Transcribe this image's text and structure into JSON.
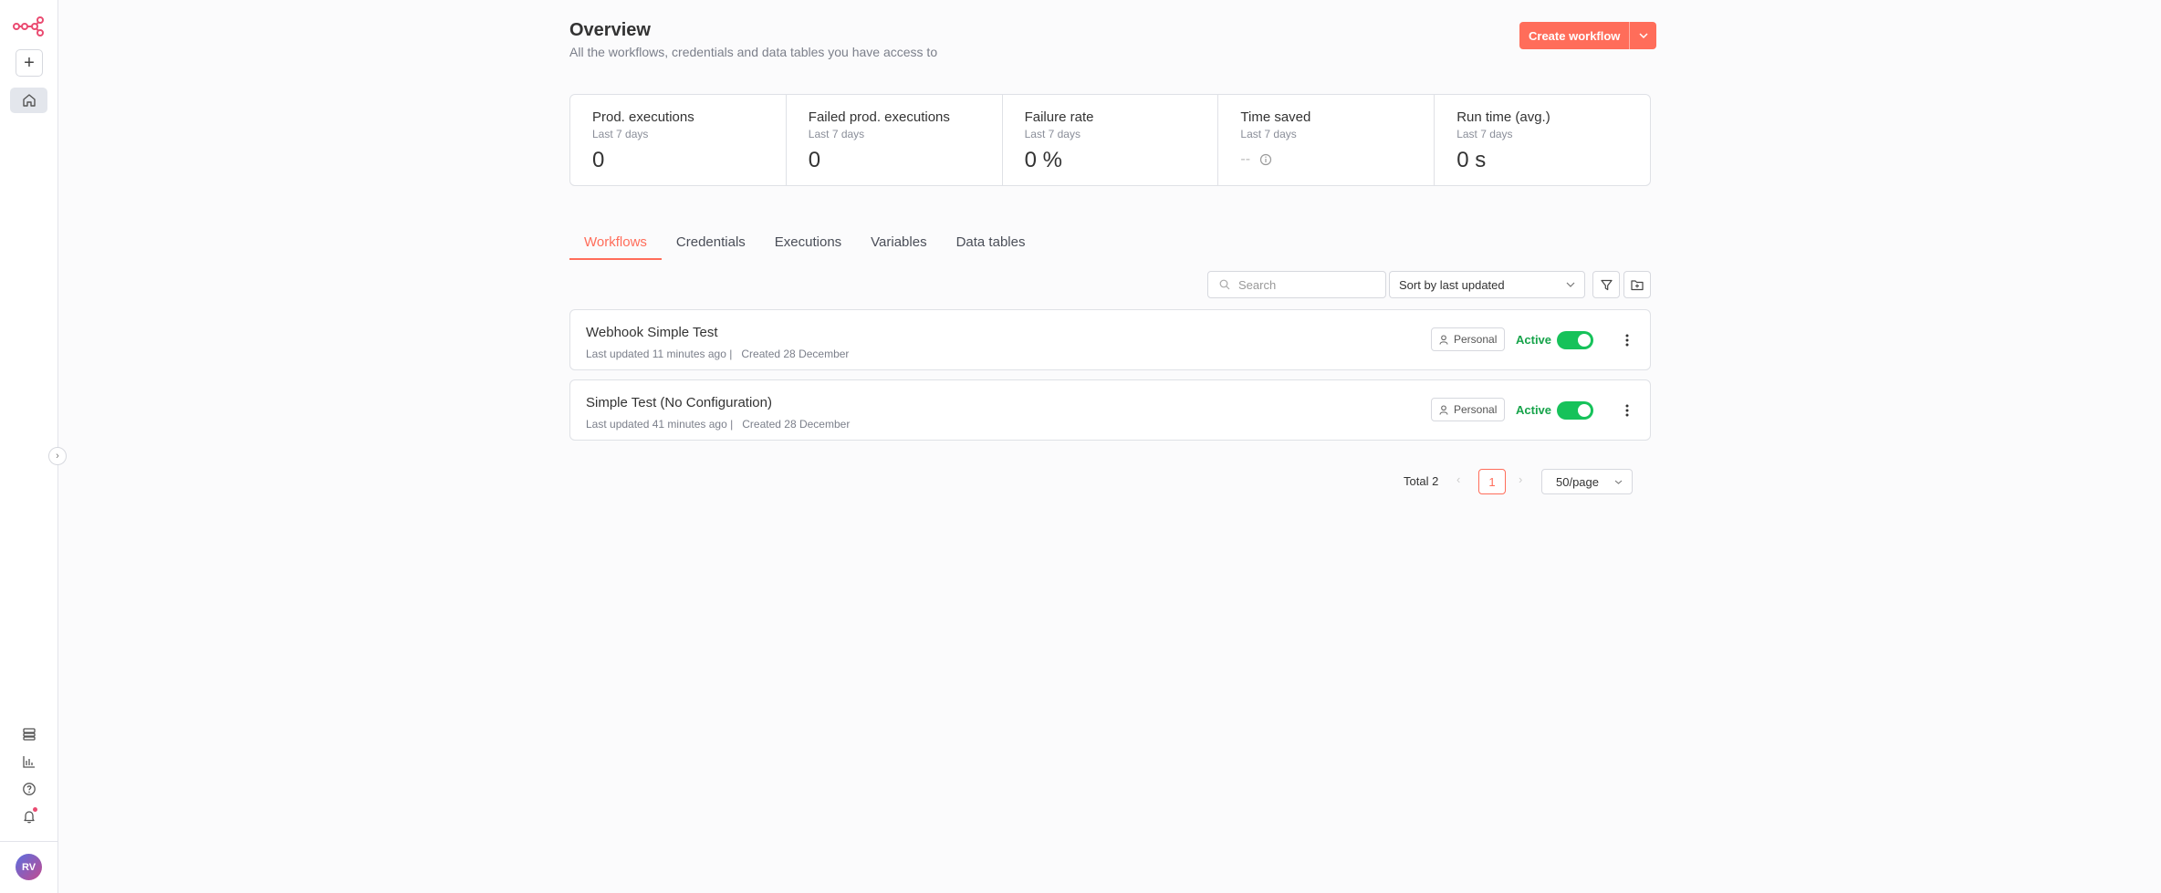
{
  "colors": {
    "accent": "#ff6d5a",
    "active": "#16a34a",
    "toggle": "#16c25a",
    "notification": "#ea4b71"
  },
  "sidebar": {
    "add_label": "+",
    "avatar_initials": "RV",
    "icons": [
      "logo-icon",
      "plus-icon",
      "home-icon",
      "templates-icon",
      "insights-icon",
      "help-icon",
      "bell-icon"
    ]
  },
  "header": {
    "title": "Overview",
    "subtitle": "All the workflows, credentials and data tables you have access to",
    "create_label": "Create workflow"
  },
  "stats": [
    {
      "label": "Prod. executions",
      "period": "Last 7 days",
      "value": "0"
    },
    {
      "label": "Failed prod. executions",
      "period": "Last 7 days",
      "value": "0"
    },
    {
      "label": "Failure rate",
      "period": "Last 7 days",
      "value": "0 %"
    },
    {
      "label": "Time saved",
      "period": "Last 7 days",
      "value": "--"
    },
    {
      "label": "Run time (avg.)",
      "period": "Last 7 days",
      "value": "0 s"
    }
  ],
  "tabs": [
    {
      "label": "Workflows",
      "active": true
    },
    {
      "label": "Credentials"
    },
    {
      "label": "Executions"
    },
    {
      "label": "Variables"
    },
    {
      "label": "Data tables"
    }
  ],
  "toolbar": {
    "search_placeholder": "Search",
    "sort_value": "Sort by last updated"
  },
  "workflows": [
    {
      "name": "Webhook Simple Test",
      "updated": "Last updated 11 minutes ago",
      "created": "Created 28 December",
      "project": "Personal",
      "status": "Active",
      "active": true
    },
    {
      "name": "Simple Test (No Configuration)",
      "updated": "Last updated 41 minutes ago",
      "created": "Created 28 December",
      "project": "Personal",
      "status": "Active",
      "active": true
    }
  ],
  "pagination": {
    "total": "Total 2",
    "current_page": "1",
    "per_page": "50/page"
  }
}
